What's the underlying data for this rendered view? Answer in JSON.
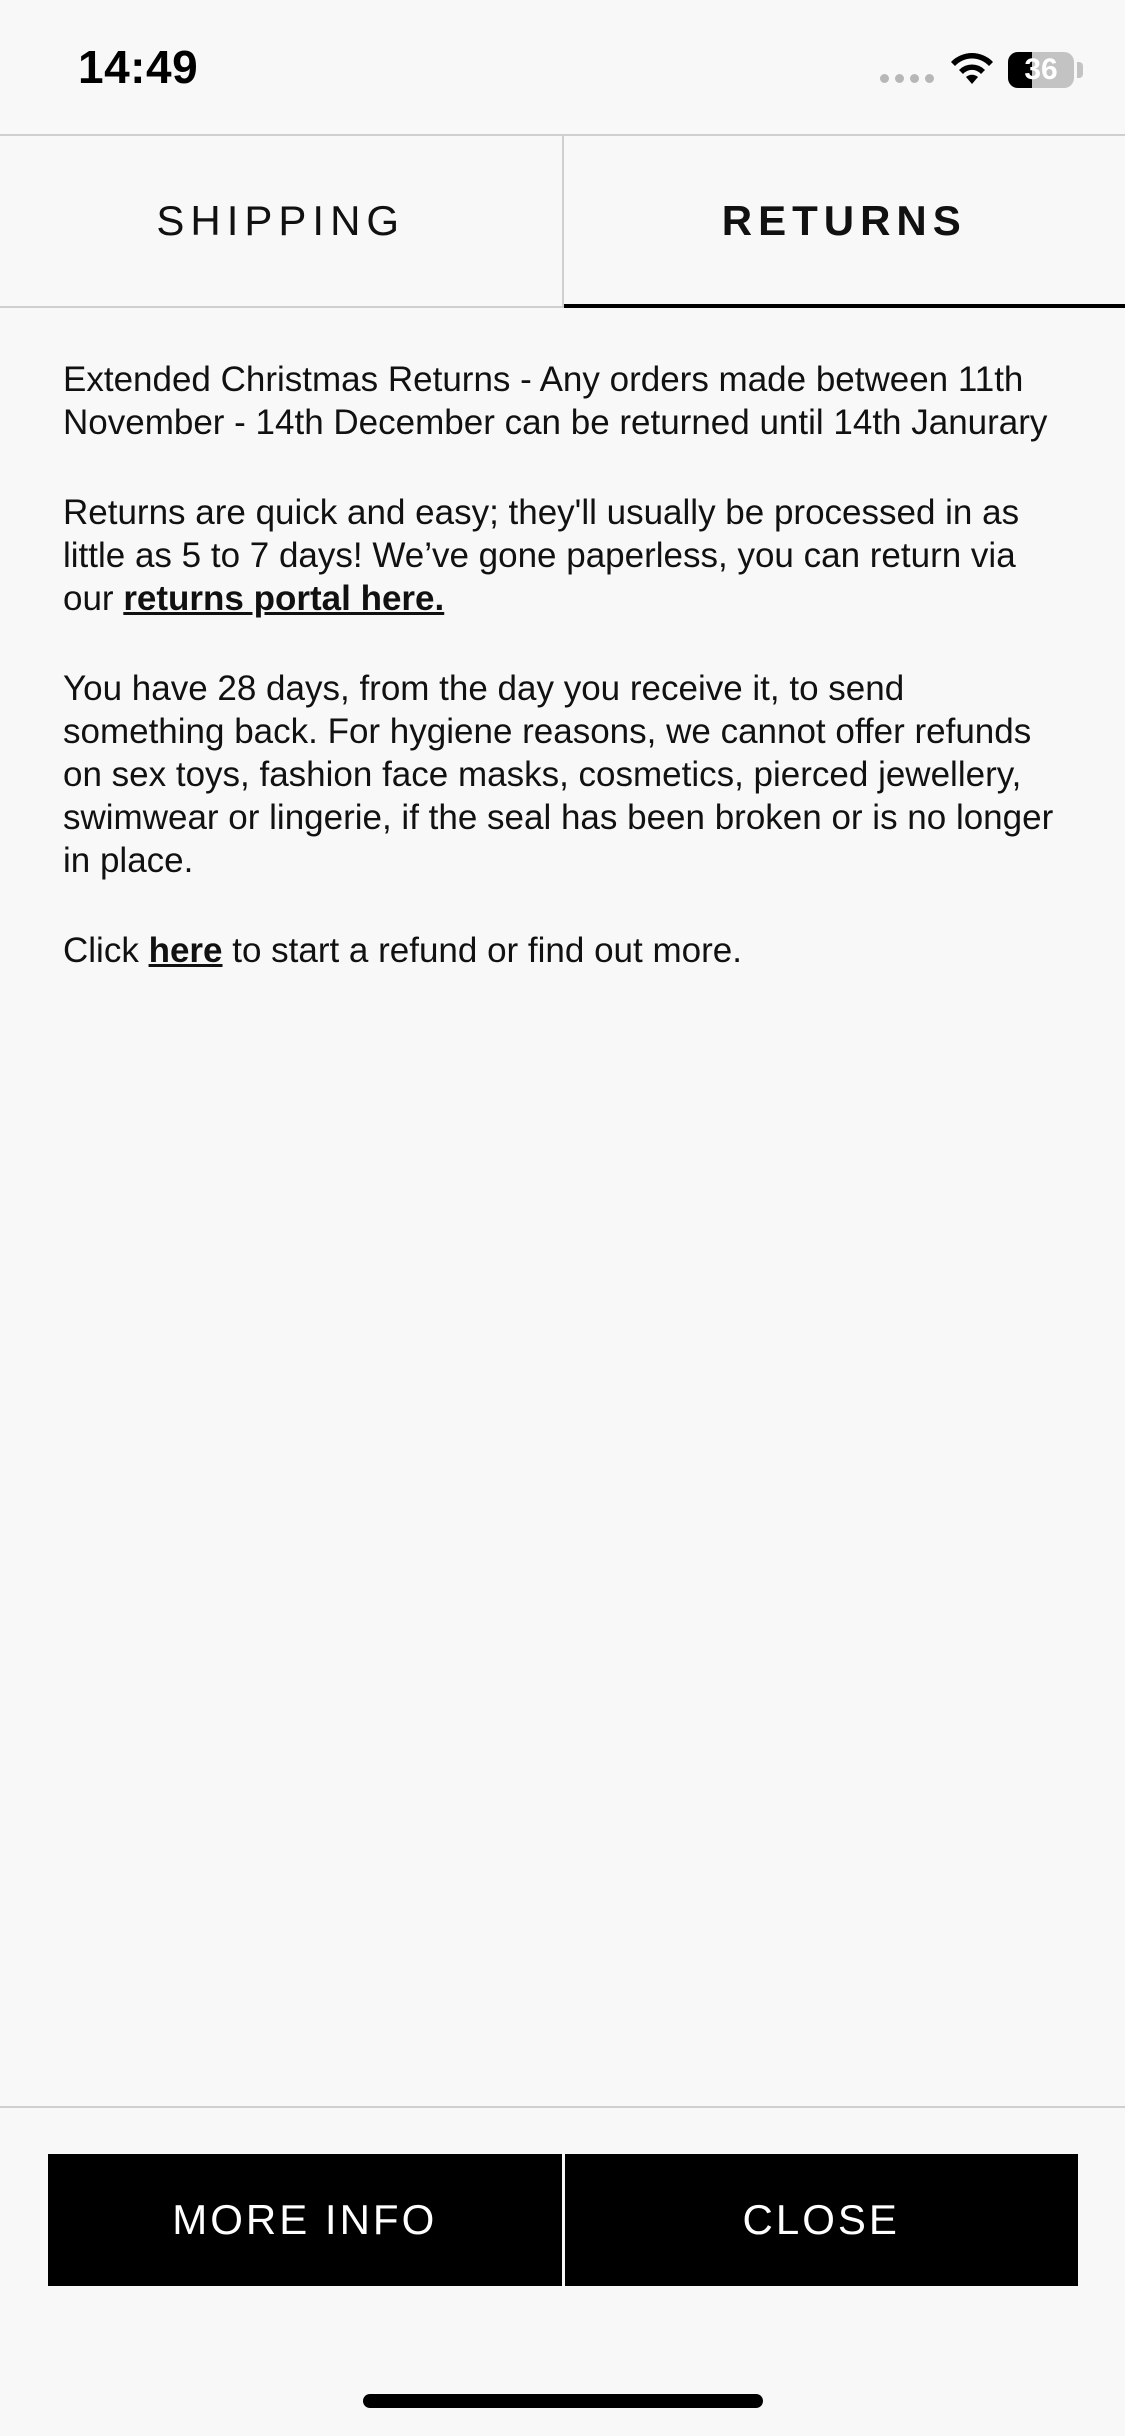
{
  "status_bar": {
    "time": "14:49",
    "battery_level": "36",
    "battery_fraction": 0.36,
    "icons": [
      "signal-dots-icon",
      "wifi-icon",
      "battery-icon"
    ]
  },
  "tabs": [
    {
      "label": "SHIPPING",
      "active": false
    },
    {
      "label": "RETURNS",
      "active": true
    }
  ],
  "content": {
    "para1": "Extended Christmas Returns - Any orders made between 11th November - 14th December can be returned until 14th Janurary",
    "para2_text": "Returns are quick and easy; they'll usually be processed in as little as 5 to 7 days! We’ve gone paperless, you can return via our ",
    "para2_link": "returns portal here.",
    "para3": "You have 28 days, from the day you receive it, to send something back. For hygiene reasons, we cannot offer refunds on sex toys, fashion face masks, cosmetics, pierced jewellery, swimwear or lingerie, if the seal has been broken or is no longer in place.",
    "para4_prefix": "Click ",
    "para4_link": "here",
    "para4_suffix": " to start a refund or find out more."
  },
  "footer": {
    "more_info_label": "MORE INFO",
    "close_label": "CLOSE"
  }
}
